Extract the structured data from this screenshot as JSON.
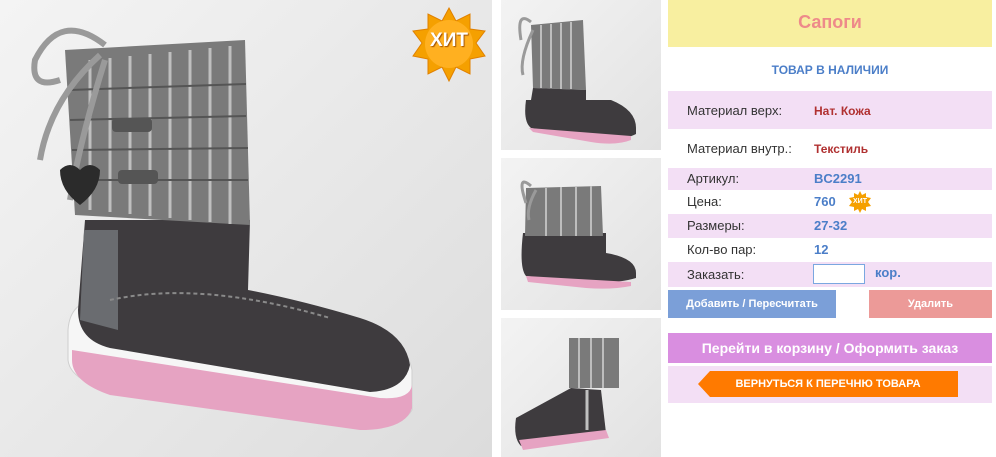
{
  "product": {
    "title": "Сапоги",
    "stock_status": "ТОВАР В НАЛИЧИИ",
    "hit_badge": "ХИТ",
    "mini_hit_badge": "ХИТ"
  },
  "specs": {
    "material_upper_label": "Материал верх:",
    "material_upper_value": "Нат. Кожа",
    "material_inner_label": "Материал внутр.:",
    "material_inner_value": "Текстиль",
    "article_label": "Артикул:",
    "article_value": "BC2291",
    "price_label": "Цена:",
    "price_value": "760",
    "sizes_label": "Размеры:",
    "sizes_value": "27-32",
    "pairs_label": "Кол-во пар:",
    "pairs_value": "12",
    "order_label": "Заказать:",
    "order_value": "",
    "order_unit": "кор."
  },
  "buttons": {
    "add_recalc": "Добавить / Пересчитать",
    "delete": "Удалить",
    "go_to_cart": "Перейти в корзину / Оформить заказ",
    "back_to_list": "ВЕРНУТЬСЯ К ПЕРЕЧНЮ ТОВАРА"
  },
  "colors": {
    "title_bg": "#f8efa0",
    "title_text": "#ee8a8a",
    "accent_blue": "#4b7ec8",
    "row_shade": "#f3dff5",
    "add_button": "#7b9fd8",
    "delete_button": "#ec9a98",
    "cart_button": "#d98ee0",
    "back_button": "#ff7a00",
    "badge_orange": "#f5a000"
  },
  "images": {
    "main": "boot-photo-side",
    "thumbnails": [
      "boot-photo-side-small",
      "boot-photo-cuff-folded",
      "boot-photo-zipper-side"
    ]
  }
}
